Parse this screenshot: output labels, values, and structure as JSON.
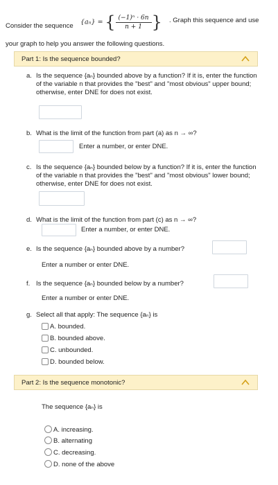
{
  "intro": {
    "consider": "Consider the sequence",
    "seq_symbol": "{aₙ} =",
    "frac_num": "(−1)ⁿ · 6n",
    "frac_den": "n + 1",
    "graph_text": ". Graph this sequence and use",
    "line2": "your graph to help you answer the following questions."
  },
  "part1": {
    "title": "Part 1: Is the sequence bounded?",
    "questions": {
      "a": {
        "letter": "a.",
        "text": "Is the sequence {aₙ} bounded above by a function? If it is, enter the function of the variable n that provides the \"best\" and \"most obvious\" upper bound; otherwise, enter DNE for does not exist."
      },
      "b": {
        "letter": "b.",
        "text": "What is the limit of the function from part (a) as n → ∞?",
        "hint": "Enter a number, or enter DNE."
      },
      "c": {
        "letter": "c.",
        "text": "Is the sequence {aₙ} bounded below by a function? If it is, enter the function of the variable n that provides the \"best\" and \"most obvious\" lower bound; otherwise, enter DNE for does not exist."
      },
      "d": {
        "letter": "d.",
        "text": "What is the limit of the function from part (c) as n → ∞?",
        "hint": "Enter a number, or enter DNE."
      },
      "e": {
        "letter": "e.",
        "text": "Is the sequence {aₙ} bounded above by a number?",
        "hint": "Enter a number or enter DNE."
      },
      "f": {
        "letter": "f.",
        "text": "Is the sequence {aₙ} bounded below by a number?",
        "hint": "Enter a number or enter DNE."
      },
      "g": {
        "letter": "g.",
        "text": "Select all that apply: The sequence {aₙ} is",
        "options": [
          "A. bounded.",
          "B. bounded above.",
          "C. unbounded.",
          "D. bounded below."
        ]
      }
    }
  },
  "part2": {
    "title": "Part 2: Is the sequence monotonic?",
    "intro": "The sequence {aₙ} is",
    "options": [
      "A. increasing.",
      "B. alternating",
      "C. decreasing.",
      "D. none of the above"
    ]
  },
  "colors": {
    "part_bar_bg": "#fdf1c9",
    "chevron": "#d4a017",
    "input_border": "#cfd6de"
  },
  "icons": {
    "collapse": "chevron-up-icon",
    "expand": "chevron-down-icon"
  }
}
